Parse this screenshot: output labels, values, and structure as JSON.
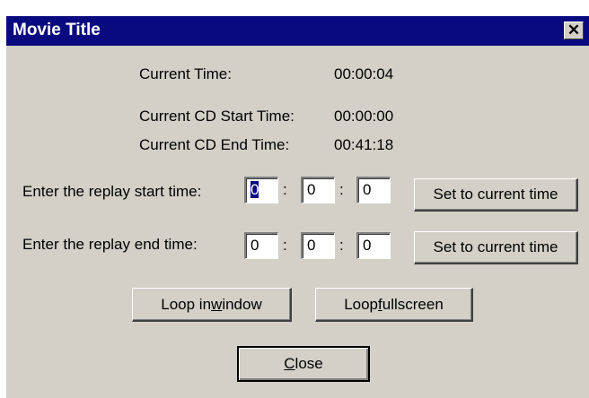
{
  "window": {
    "title": "Movie Title",
    "close_glyph": "✕"
  },
  "info": {
    "current_time_label": "Current Time:",
    "current_time_value": "00:00:04",
    "cd_start_label": "Current CD Start Time:",
    "cd_start_value": "00:00:00",
    "cd_end_label": "Current CD End Time:",
    "cd_end_value": "00:41:18"
  },
  "replay_start": {
    "label": "Enter the replay start time:",
    "hours": "0",
    "minutes": "0",
    "seconds": "0",
    "button": "Set to current time"
  },
  "replay_end": {
    "label": "Enter the replay end time:",
    "hours": "0",
    "minutes": "0",
    "seconds": "0",
    "button": "Set to current time"
  },
  "separator": ":",
  "buttons": {
    "loop_window_pre": "Loop in ",
    "loop_window_key": "w",
    "loop_window_post": "indow",
    "loop_full_pre": "Loop ",
    "loop_full_key": "f",
    "loop_full_post": "ullscreen",
    "close_key": "C",
    "close_post": "lose"
  }
}
